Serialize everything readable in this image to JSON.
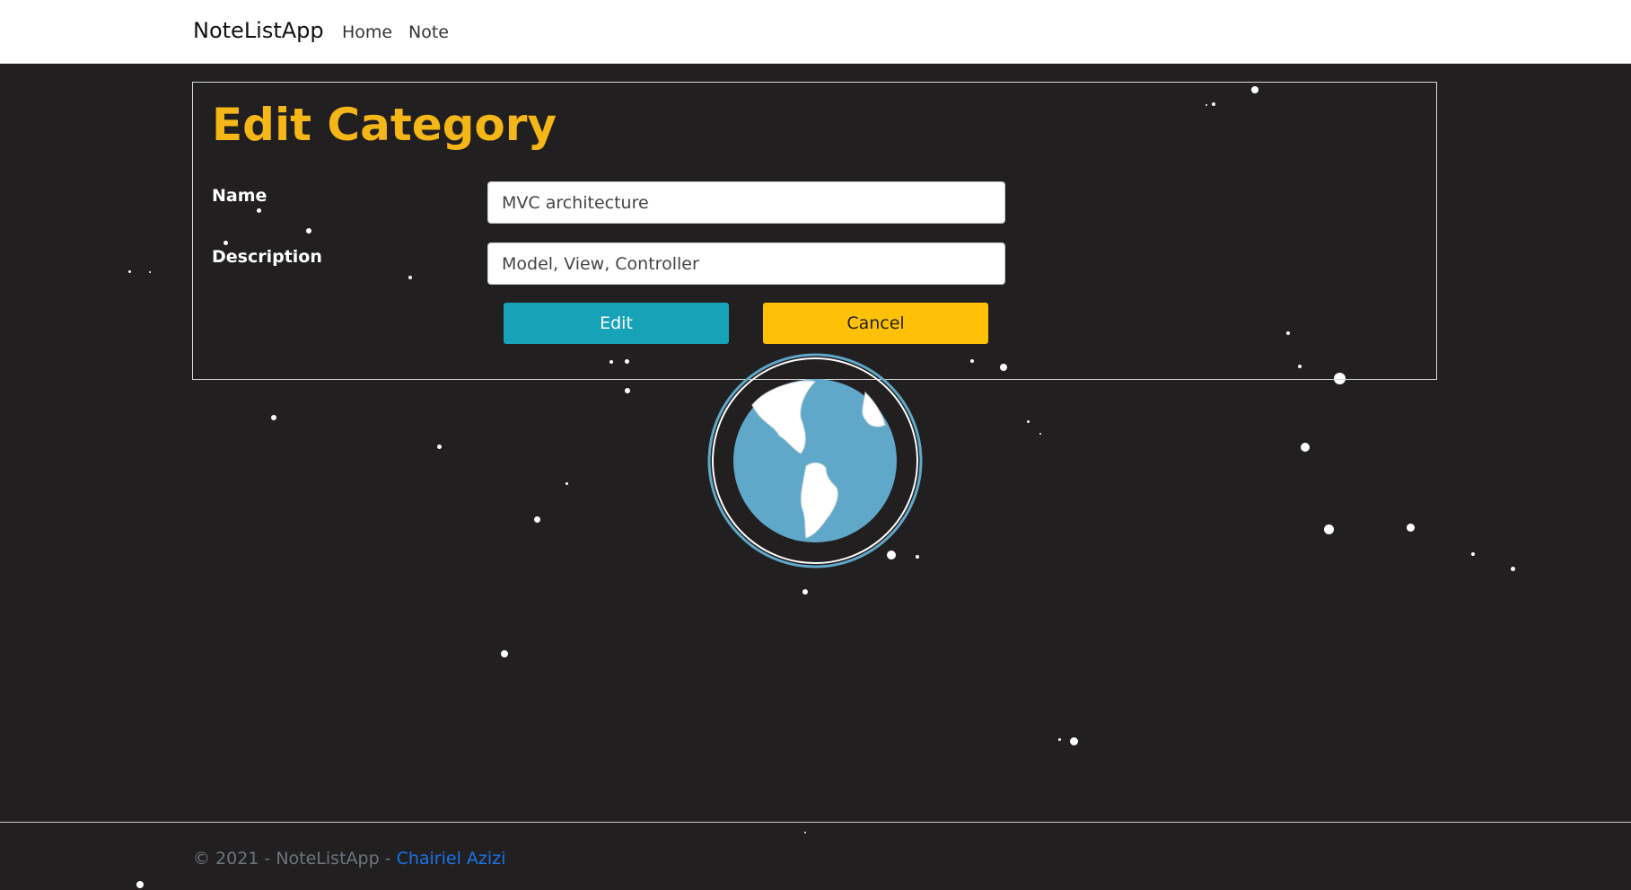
{
  "navbar": {
    "brand": "NoteListApp",
    "links": [
      {
        "label": "Home"
      },
      {
        "label": "Note"
      }
    ]
  },
  "form": {
    "title": "Edit Category",
    "fields": [
      {
        "label": "Name",
        "value": "MVC architecture"
      },
      {
        "label": "Description",
        "value": "Model, View, Controller"
      }
    ],
    "edit_label": "Edit",
    "cancel_label": "Cancel"
  },
  "footer": {
    "text": "© 2021 - NoteListApp - ",
    "author": "Chairiel Azizi"
  },
  "colors": {
    "background": "#221f20",
    "title": "#f5b617",
    "edit_button": "#17a2b8",
    "cancel_button": "#ffc107",
    "globe_ocean": "#5fa8c9",
    "link": "#1a73e8"
  },
  "icons": {
    "globe": "earth-globe-icon",
    "stars": "star-dot"
  }
}
